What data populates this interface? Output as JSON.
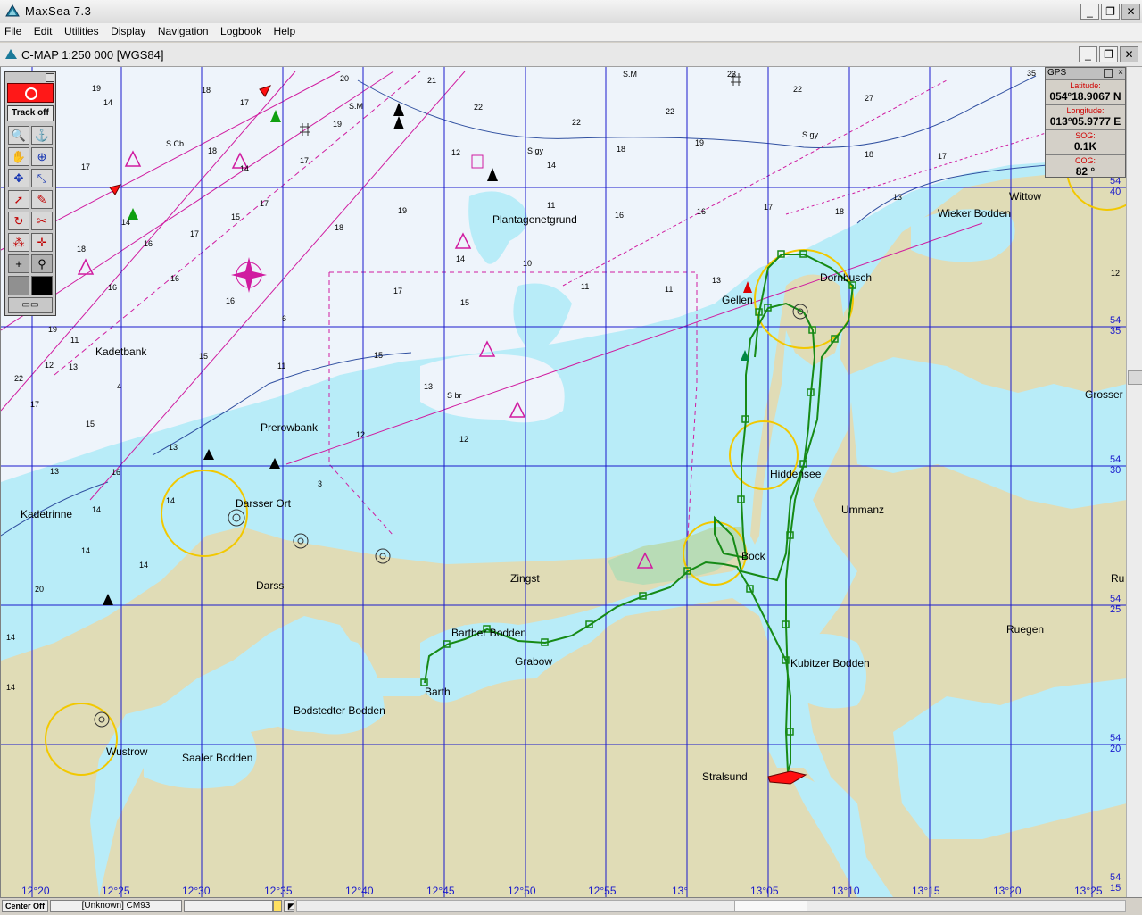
{
  "window": {
    "title": "MaxSea 7.3",
    "minimize": "_",
    "restore": "❐",
    "close": "✕"
  },
  "menu": [
    "File",
    "Edit",
    "Utilities",
    "Display",
    "Navigation",
    "Logbook",
    "Help"
  ],
  "chart_window": {
    "title": "C-MAP  1:250 000 [WGS84]"
  },
  "toolbox": {
    "track_label": "Track off"
  },
  "gps": {
    "header": "GPS",
    "lat_label": "Latitude:",
    "lat_value": "054°18.9067 N",
    "lon_label": "Longitude:",
    "lon_value": "013°05.9777 E",
    "sog_label": "SOG:",
    "sog_value": "0.1K",
    "cog_label": "COG:",
    "cog_value": "82 °"
  },
  "map": {
    "place_names": [
      {
        "text": "Wittow"
      },
      {
        "text": "Wieker Bodden"
      },
      {
        "text": "Dornbusch"
      },
      {
        "text": "Gellen"
      },
      {
        "text": "Plantagenetgrund"
      },
      {
        "text": "Kadetbank"
      },
      {
        "text": "Prerowbank"
      },
      {
        "text": "Darsser Ort"
      },
      {
        "text": "Kadetrinne"
      },
      {
        "text": "Darss"
      },
      {
        "text": "Zingst"
      },
      {
        "text": "Hiddensee"
      },
      {
        "text": "Ummanz"
      },
      {
        "text": "Bock"
      },
      {
        "text": "Barther Bodden"
      },
      {
        "text": "Grabow"
      },
      {
        "text": "Barth"
      },
      {
        "text": "Kubitzer Bodden"
      },
      {
        "text": "Ruegen"
      },
      {
        "text": "Bodstedter Bodden"
      },
      {
        "text": "Wustrow"
      },
      {
        "text": "Saaler Bodden"
      },
      {
        "text": "Stralsund"
      },
      {
        "text": "Grosser"
      },
      {
        "text": "Ru"
      }
    ],
    "lon_labels": [
      "12°20",
      "12°25",
      "12°30",
      "12°35",
      "12°40",
      "12°45",
      "12°50",
      "12°55",
      "13°",
      "13°05",
      "13°10",
      "13°15",
      "13°20",
      "13°25",
      "13°15"
    ],
    "lat_labels": [
      "54 40",
      "54 35",
      "54 30",
      "54 25",
      "54 20",
      "54 15"
    ]
  },
  "status": {
    "center": "Center Off",
    "source": "[Unknown]  CM93"
  },
  "colors": {
    "land": "#e0dcb6",
    "shallow": "#b8ecf8",
    "deep": "#eef4fb",
    "grid": "#1a1acc",
    "track": "#168a16",
    "route": "#d01ca0",
    "light_ring": "#ffd700"
  }
}
